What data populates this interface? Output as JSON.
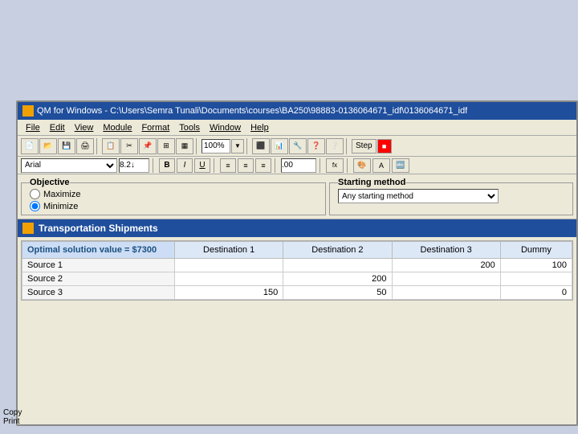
{
  "window": {
    "title": "QM for Windows - C:\\Users\\Semra Tunali\\Documents\\courses\\BA250\\98883-0136064671_idf\\0136064671_idf",
    "bg": "#c8cfe0"
  },
  "menu": {
    "items": [
      "File",
      "Edit",
      "View",
      "Module",
      "Format",
      "Tools",
      "Window",
      "Help"
    ]
  },
  "toolbar": {
    "zoom": "100%",
    "step_label": "Step"
  },
  "format_bar": {
    "font": "Arial",
    "size": "8.2↓"
  },
  "objective": {
    "title": "Objective",
    "options": [
      "Maximize",
      "Minimize"
    ],
    "selected": "Minimize"
  },
  "starting_method": {
    "title": "Starting method",
    "value": "Any starting method"
  },
  "transport": {
    "title": "Transportation Shipments",
    "optimal_label": "Optimal solution value = $7300",
    "columns": [
      "Destination 1",
      "Destination 2",
      "Destination 3",
      "Dummy"
    ],
    "rows": [
      {
        "label": "Source 1",
        "values": [
          "",
          "",
          "200",
          "100"
        ]
      },
      {
        "label": "Source 2",
        "values": [
          "",
          "200",
          "",
          ""
        ]
      },
      {
        "label": "Source 3",
        "values": [
          "150",
          "50",
          "",
          "0"
        ]
      }
    ]
  },
  "bottom": {
    "copy": "Copy",
    "print": "Print"
  }
}
